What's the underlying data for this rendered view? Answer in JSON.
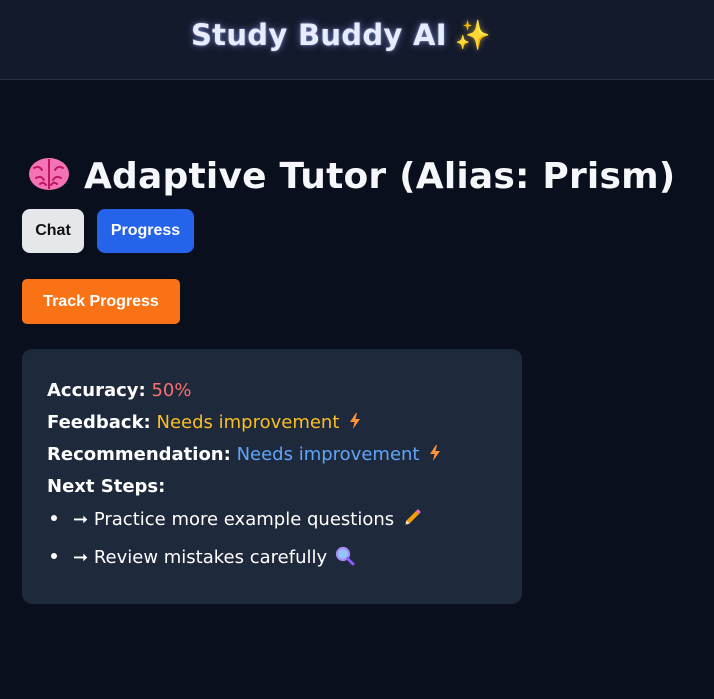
{
  "header": {
    "title": "Study Buddy AI",
    "title_icon": "sparkles-icon"
  },
  "main": {
    "title": "Adaptive Tutor (Alias: Prism)",
    "title_icon": "brain-icon",
    "tabs": [
      {
        "label": "Chat",
        "active": false
      },
      {
        "label": "Progress",
        "active": true
      }
    ],
    "action_button": "Track Progress"
  },
  "progress_card": {
    "accuracy_label": "Accuracy:",
    "accuracy_value": "50%",
    "feedback_label": "Feedback:",
    "feedback_value": "Needs improvement",
    "recommendation_label": "Recommendation:",
    "recommendation_value": "Needs improvement",
    "next_steps_label": "Next Steps:",
    "next_steps": [
      {
        "arrow": "➞",
        "text": "Practice more example questions",
        "icon": "pencil-icon"
      },
      {
        "arrow": "➞",
        "text": "Review mistakes carefully",
        "icon": "magnifier-icon"
      }
    ]
  },
  "colors": {
    "background": "#0a0f1e",
    "header_bg": "#131a2c",
    "card_bg": "#1e293b",
    "accent_blue": "#2563eb",
    "accent_orange": "#f97316",
    "accuracy": "#f87171",
    "feedback": "#fbbf24",
    "recommendation": "#60a5fa"
  }
}
